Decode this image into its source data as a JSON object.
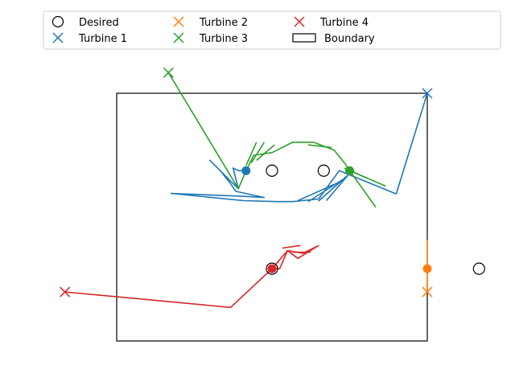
{
  "chart_data": {
    "type": "line",
    "title": "",
    "xlabel": "",
    "ylabel": "",
    "axes_visible": false,
    "xlim": [
      -1.0,
      8.0
    ],
    "ylim": [
      -1.0,
      5.0
    ],
    "legend": {
      "placement": "top",
      "columns": 4,
      "entries": [
        {
          "label": "Desired",
          "marker": "circle-open",
          "color": "#000000"
        },
        {
          "label": "Turbine 1",
          "marker": "x",
          "color": "#1f77b4"
        },
        {
          "label": "Turbine 2",
          "marker": "x",
          "color": "#ff7f0e"
        },
        {
          "label": "Turbine 3",
          "marker": "x",
          "color": "#2ca02c"
        },
        {
          "label": "Turbine 4",
          "marker": "x",
          "color": "#d62728"
        },
        {
          "label": "Boundary",
          "marker": "rect-open",
          "color": "#000000"
        }
      ]
    },
    "boundary": {
      "x": [
        0.0,
        6.0
      ],
      "y": [
        0.0,
        4.8
      ]
    },
    "desired": [
      {
        "x": 3.0,
        "y": 3.3
      },
      {
        "x": 4.0,
        "y": 3.3
      },
      {
        "x": 7.0,
        "y": 1.4
      },
      {
        "x": 3.0,
        "y": 1.4
      }
    ],
    "series": [
      {
        "name": "Turbine 1",
        "color": "#1f77b4",
        "start": {
          "x": 6.0,
          "y": 4.8
        },
        "end": {
          "x": 2.5,
          "y": 3.3
        },
        "path": [
          [
            6.0,
            4.8
          ],
          [
            5.4,
            2.85
          ],
          [
            4.3,
            3.3
          ],
          [
            3.9,
            2.75
          ],
          [
            3.4,
            2.7
          ],
          [
            3.1,
            2.7
          ],
          [
            2.45,
            2.72
          ],
          [
            1.05,
            2.86
          ],
          [
            2.5,
            2.8
          ],
          [
            2.85,
            2.78
          ],
          [
            2.3,
            2.9
          ],
          [
            2.2,
            3.05
          ],
          [
            2.0,
            3.3
          ],
          [
            1.8,
            3.5
          ],
          [
            2.1,
            3.2
          ],
          [
            2.35,
            2.95
          ],
          [
            2.25,
            3.35
          ],
          [
            2.35,
            3.3
          ],
          [
            2.5,
            3.3
          ]
        ],
        "spikes": [
          [
            [
              3.5,
              2.72
            ],
            [
              4.35,
              3.1
            ]
          ],
          [
            [
              3.7,
              2.7
            ],
            [
              4.4,
              3.15
            ]
          ],
          [
            [
              3.9,
              2.71
            ],
            [
              4.45,
              3.2
            ]
          ],
          [
            [
              4.05,
              2.72
            ],
            [
              4.5,
              3.25
            ]
          ]
        ]
      },
      {
        "name": "Turbine 2",
        "color": "#ff7f0e",
        "start": {
          "x": 6.0,
          "y": 0.95
        },
        "end": {
          "x": 6.0,
          "y": 1.4
        },
        "path": [
          [
            6.0,
            0.95
          ],
          [
            6.0,
            1.4
          ],
          [
            6.0,
            1.95
          ],
          [
            6.0,
            1.4
          ]
        ],
        "spikes": []
      },
      {
        "name": "Turbine 3",
        "color": "#2ca02c",
        "start": {
          "x": 1.0,
          "y": 5.2
        },
        "end": {
          "x": 4.5,
          "y": 3.3
        },
        "path": [
          [
            1.0,
            5.2
          ],
          [
            2.35,
            2.95
          ],
          [
            2.5,
            3.3
          ],
          [
            2.65,
            3.6
          ],
          [
            3.0,
            3.65
          ],
          [
            3.4,
            3.85
          ],
          [
            3.8,
            3.85
          ],
          [
            4.2,
            3.7
          ],
          [
            4.4,
            3.45
          ],
          [
            4.5,
            3.3
          ],
          [
            4.75,
            2.95
          ],
          [
            5.0,
            2.6
          ],
          [
            4.5,
            3.3
          ],
          [
            5.2,
            3.0
          ]
        ],
        "spikes": [
          [
            [
              2.5,
              3.4
            ],
            [
              2.7,
              3.85
            ]
          ],
          [
            [
              2.6,
              3.45
            ],
            [
              2.85,
              3.85
            ]
          ],
          [
            [
              2.7,
              3.5
            ],
            [
              3.05,
              3.8
            ]
          ],
          [
            [
              3.7,
              3.8
            ],
            [
              4.15,
              3.75
            ]
          ],
          [
            [
              4.4,
              3.35
            ],
            [
              4.85,
              3.15
            ]
          ]
        ]
      },
      {
        "name": "Turbine 4",
        "color": "#d62728",
        "start": {
          "x": -1.0,
          "y": 0.95
        },
        "end": {
          "x": 3.0,
          "y": 1.4
        },
        "path": [
          [
            -1.0,
            0.95
          ],
          [
            2.2,
            0.65
          ],
          [
            3.0,
            1.4
          ],
          [
            3.3,
            1.75
          ],
          [
            3.6,
            1.7
          ],
          [
            3.9,
            1.85
          ],
          [
            3.5,
            1.6
          ],
          [
            3.3,
            1.75
          ],
          [
            3.15,
            1.4
          ],
          [
            3.0,
            1.4
          ]
        ],
        "spikes": [
          [
            [
              3.2,
              1.8
            ],
            [
              3.55,
              1.85
            ]
          ],
          [
            [
              3.4,
              1.72
            ],
            [
              3.75,
              1.72
            ]
          ]
        ]
      }
    ]
  }
}
